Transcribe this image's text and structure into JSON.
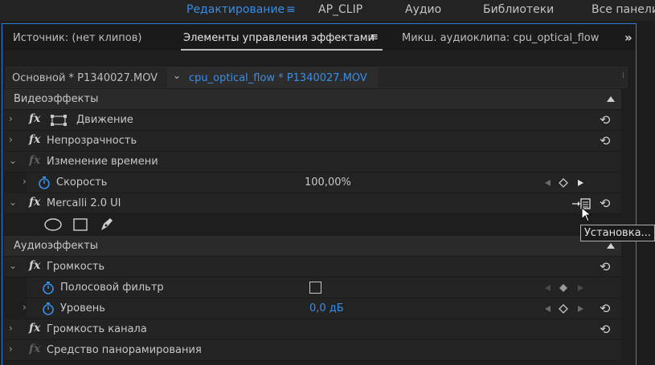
{
  "workspaces": {
    "editing": "Редактирование",
    "ap_clip": "AP_CLIP",
    "audio": "Аудио",
    "libraries": "Библиотеки",
    "all_panels": "Все панели"
  },
  "tabs": {
    "source": "Источник: (нет клипов)",
    "effect_controls": "Элементы управления эффектами",
    "audio_mixer": "Микш. аудиоклипа: cpu_optical_flow"
  },
  "source_bar": {
    "master": "Основной * P1340027.MOV",
    "clip": "cpu_optical_flow * P1340027.MOV"
  },
  "video": {
    "header": "Видеоэффекты",
    "motion": "Движение",
    "opacity": "Непрозрачность",
    "time_remap": "Изменение времени",
    "speed": "Скорость",
    "speed_value": "100,00%",
    "mercalli": "Mercalli 2.0 UI"
  },
  "audio": {
    "header": "Аудиоэффекты",
    "volume": "Громкость",
    "bypass": "Полосовой фильтр",
    "level": "Уровень",
    "level_value": "0,0 дБ",
    "channel_volume": "Громкость канала",
    "panner": "Средство панорамирования"
  },
  "tooltip": "Установка...",
  "icons": {
    "menu": "hamburger-icon",
    "overflow": "double-chevron-right-icon",
    "reset": "reset-icon",
    "stopwatch": "stopwatch-icon",
    "setup": "setup-dialog-icon"
  },
  "colors": {
    "accent": "#3a8ee6"
  }
}
